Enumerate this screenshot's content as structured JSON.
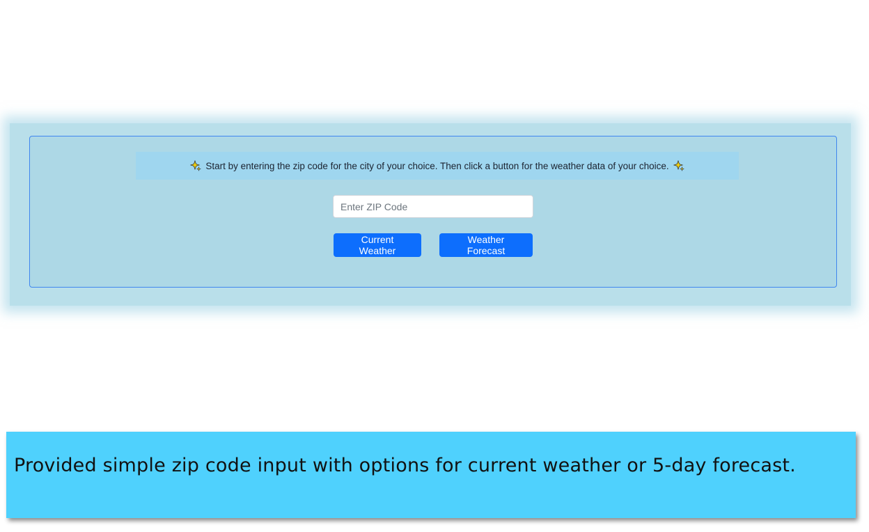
{
  "banner": {
    "text": "Start by entering the zip code for the city of your choice. Then click a button for the weather data of your choice.",
    "icon": "sparkle-icon"
  },
  "zip": {
    "placeholder": "Enter ZIP Code",
    "value": ""
  },
  "buttons": {
    "current_label": "Current Weather",
    "forecast_label": "Weather Forecast"
  },
  "caption": {
    "text": "Provided simple zip code input with options for current weather or 5-day forecast."
  },
  "colors": {
    "card_bg": "#add8e6",
    "banner_bg": "#9fd6ef",
    "button_primary": "#0d6efd",
    "caption_bg": "#4fd1fd"
  }
}
